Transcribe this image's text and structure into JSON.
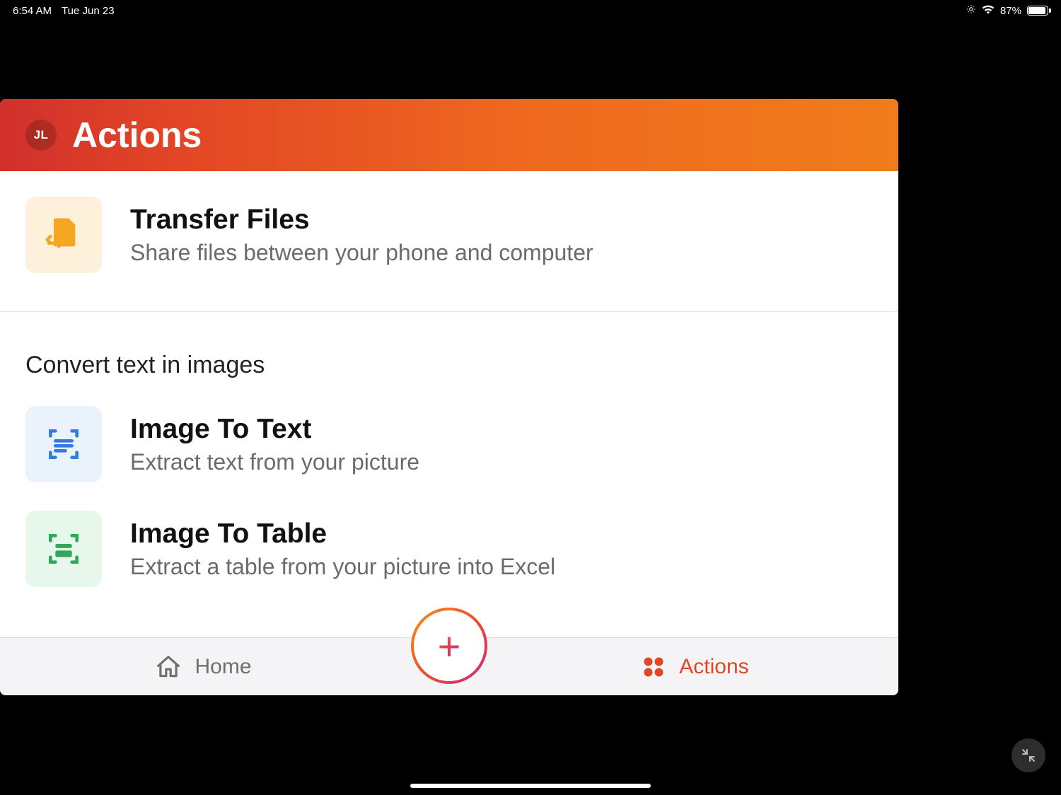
{
  "status": {
    "time": "6:54 AM",
    "date": "Tue Jun 23",
    "battery_pct": "87%"
  },
  "header": {
    "avatar_initials": "JL",
    "title": "Actions"
  },
  "actions": {
    "transfer": {
      "title": "Transfer Files",
      "desc": "Share files between your phone and computer"
    },
    "section_convert_header": "Convert text in images",
    "image_to_text": {
      "title": "Image To Text",
      "desc": "Extract text from your picture"
    },
    "image_to_table": {
      "title": "Image To Table",
      "desc": "Extract a table from your picture into Excel"
    }
  },
  "tabs": {
    "home": "Home",
    "actions": "Actions"
  }
}
